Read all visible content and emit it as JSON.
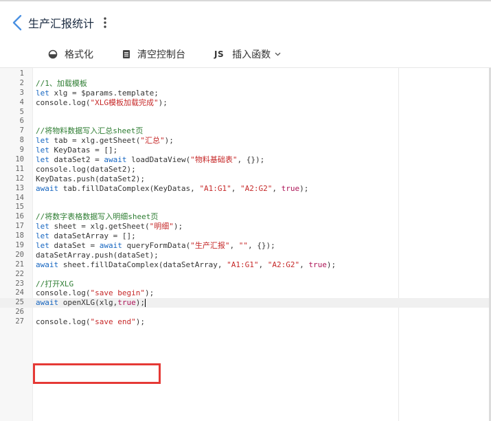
{
  "header": {
    "title": "生产汇报统计"
  },
  "toolbar": {
    "format_label": "格式化",
    "clear_console_label": "清空控制台",
    "js_badge": "JS",
    "insert_function_label": "插入函数"
  },
  "editor": {
    "active_line": 25,
    "lines": [
      {
        "n": "1",
        "t": ""
      },
      {
        "n": "2",
        "t": "//1、加载模板"
      },
      {
        "n": "3",
        "t": "let xlg = $params.template;"
      },
      {
        "n": "4",
        "t": "console.log(\"XLG模板加载完成\");"
      },
      {
        "n": "5",
        "t": ""
      },
      {
        "n": "6",
        "t": ""
      },
      {
        "n": "7",
        "t": "//将物料数据写入汇总sheet页"
      },
      {
        "n": "8",
        "t": "let tab = xlg.getSheet(\"汇总\");"
      },
      {
        "n": "9",
        "t": "let KeyDatas = [];"
      },
      {
        "n": "10",
        "t": "let dataSet2 = await loadDataView(\"物料基础表\", {});"
      },
      {
        "n": "11",
        "t": "console.log(dataSet2);"
      },
      {
        "n": "12",
        "t": "KeyDatas.push(dataSet2);"
      },
      {
        "n": "13",
        "t": "await tab.fillDataComplex(KeyDatas, \"A1:G1\", \"A2:G2\", true);"
      },
      {
        "n": "14",
        "t": ""
      },
      {
        "n": "15",
        "t": ""
      },
      {
        "n": "16",
        "t": "//将数字表格数据写入明细sheet页"
      },
      {
        "n": "17",
        "t": "let sheet = xlg.getSheet(\"明细\");"
      },
      {
        "n": "18",
        "t": "let dataSetArray = [];"
      },
      {
        "n": "19",
        "t": "let dataSet = await queryFormData(\"生产汇报\", \"\", {});"
      },
      {
        "n": "20",
        "t": "dataSetArray.push(dataSet);"
      },
      {
        "n": "21",
        "t": "await sheet.fillDataComplex(dataSetArray, \"A1:G1\", \"A2:G2\", true);"
      },
      {
        "n": "22",
        "t": ""
      },
      {
        "n": "23",
        "t": "//打开XLG"
      },
      {
        "n": "24",
        "t": "console.log(\"save begin\");"
      },
      {
        "n": "25",
        "t": "await openXLG(xlg,true);"
      },
      {
        "n": "26",
        "t": ""
      },
      {
        "n": "27",
        "t": "console.log(\"save end\");"
      }
    ]
  },
  "colors": {
    "keyword": "#1565c0",
    "comment": "#2e7d32",
    "string": "#c62828",
    "boolean": "#ad1457",
    "highlight_border": "#e53935",
    "back_arrow": "#4a90e2"
  }
}
